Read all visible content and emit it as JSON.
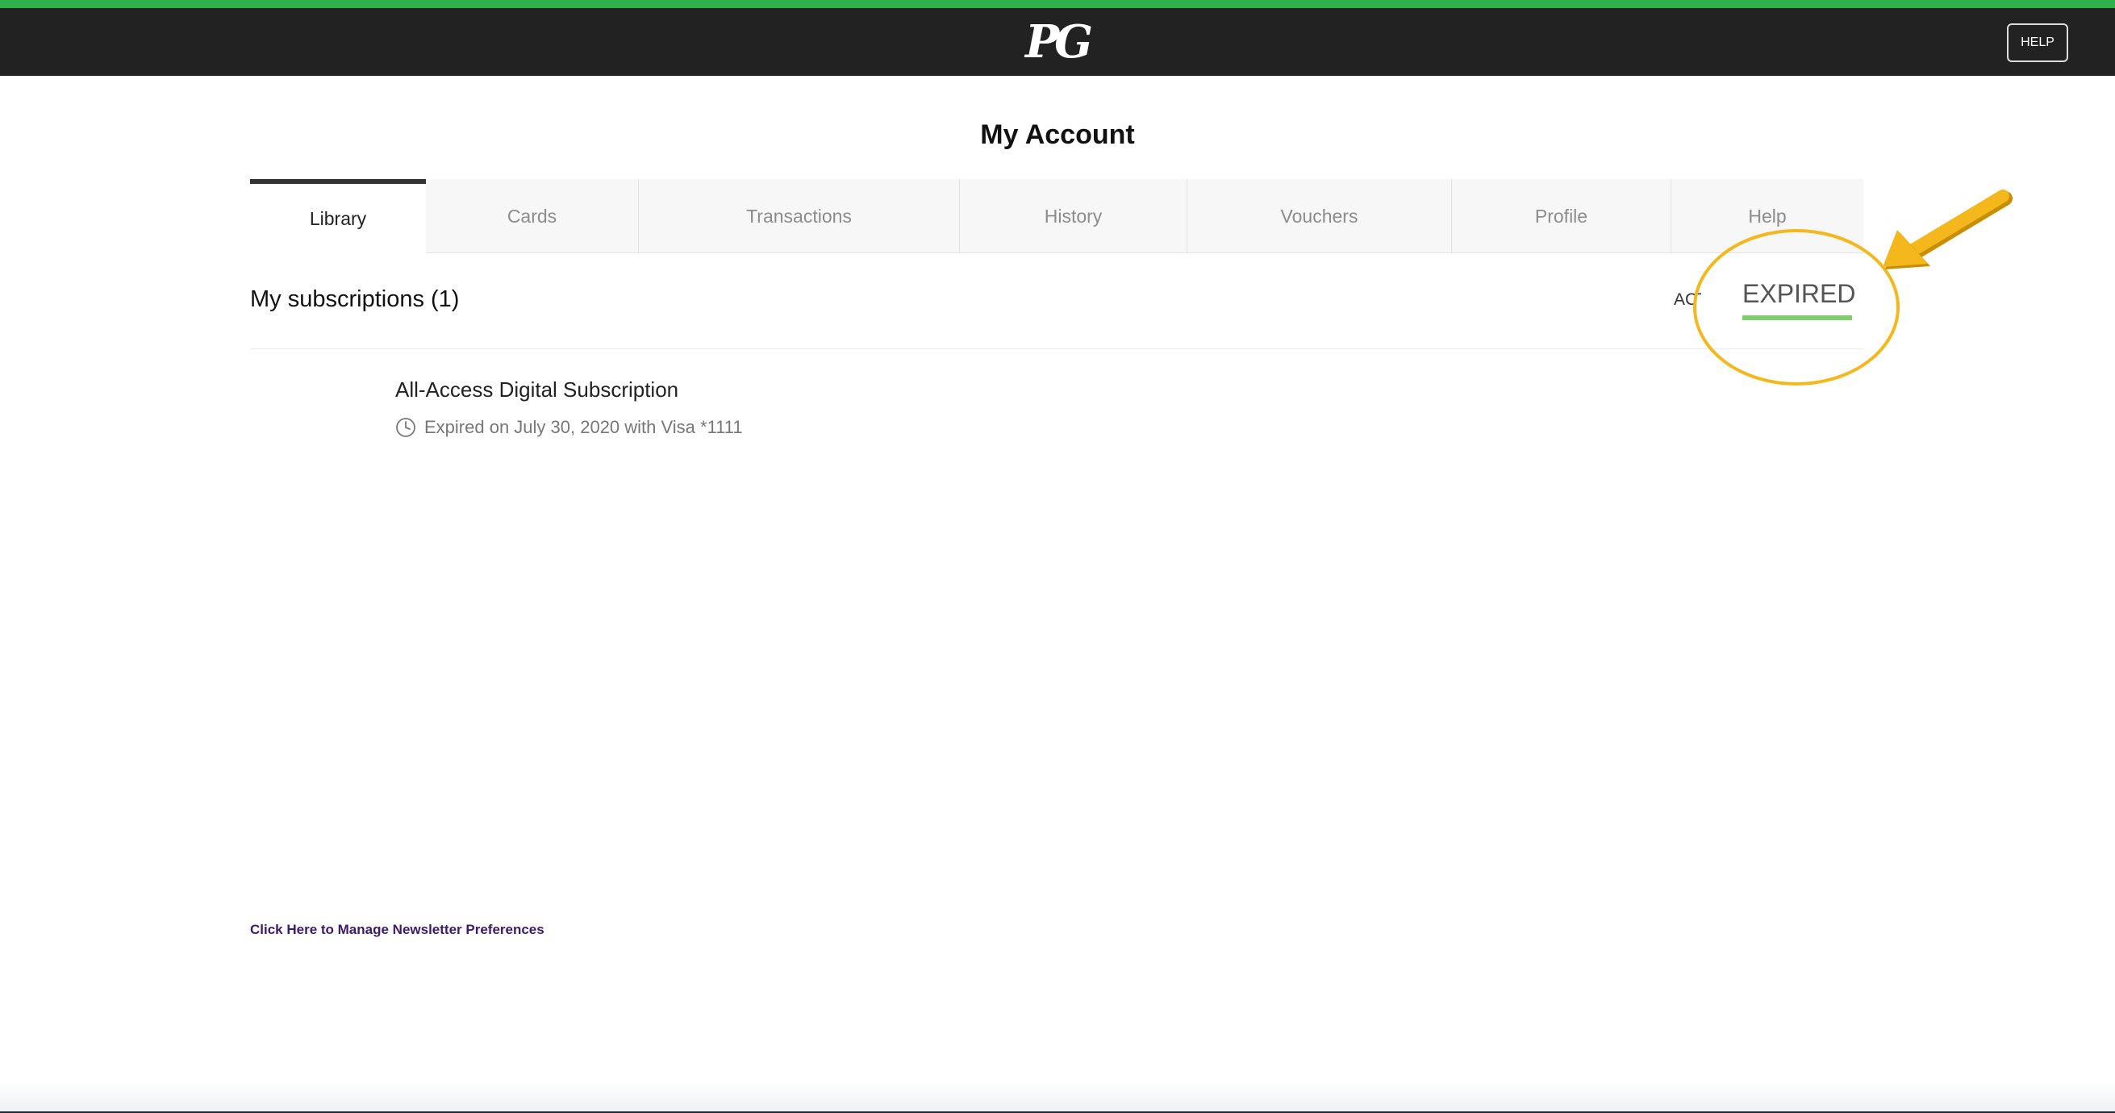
{
  "header": {
    "logo_text": "PG",
    "help_button": "HELP"
  },
  "page": {
    "title": "My Account"
  },
  "tabs": [
    {
      "label": "Library",
      "active": true
    },
    {
      "label": "Cards",
      "active": false
    },
    {
      "label": "Transactions",
      "active": false
    },
    {
      "label": "History",
      "active": false
    },
    {
      "label": "Vouchers",
      "active": false
    },
    {
      "label": "Profile",
      "active": false
    },
    {
      "label": "Help",
      "active": false
    }
  ],
  "library": {
    "section_title": "My subscriptions (1)",
    "filters": {
      "active_label": "ACTIVE",
      "expired_label": "EXPIRED",
      "selected": "EXPIRED"
    },
    "subscriptions": [
      {
        "name": "All-Access Digital Subscription",
        "status_text": "Expired on July 30, 2020 with Visa *1111"
      }
    ]
  },
  "footer": {
    "newsletter_link": "Click Here to Manage Newsletter Preferences"
  },
  "colors": {
    "top_strip": "#2fb24c",
    "header_bg": "#222222",
    "expired_underline": "#7dcf6a",
    "annotation": "#f5b81c",
    "link": "#3d1a6e"
  },
  "icons": {
    "clock": "clock-icon",
    "arrow": "arrow-annotation-icon"
  }
}
